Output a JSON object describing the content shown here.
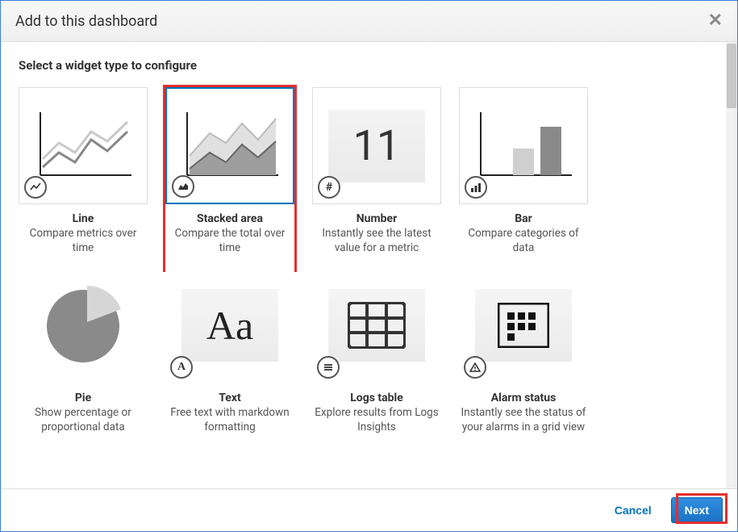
{
  "modal": {
    "title": "Add to this dashboard"
  },
  "section": {
    "title": "Select a widget type to configure"
  },
  "widgets": [
    {
      "id": "line",
      "name": "Line",
      "desc": "Compare metrics over time"
    },
    {
      "id": "area",
      "name": "Stacked area",
      "desc": "Compare the total over time",
      "selected": true
    },
    {
      "id": "number",
      "name": "Number",
      "desc": "Instantly see the latest value for a metric",
      "sample": "11"
    },
    {
      "id": "bar",
      "name": "Bar",
      "desc": "Compare categories of data"
    },
    {
      "id": "pie",
      "name": "Pie",
      "desc": "Show percentage or proportional data"
    },
    {
      "id": "text",
      "name": "Text",
      "desc": "Free text with markdown formatting",
      "sample": "Aa"
    },
    {
      "id": "logs",
      "name": "Logs table",
      "desc": "Explore results from Logs Insights"
    },
    {
      "id": "alarm",
      "name": "Alarm status",
      "desc": "Instantly see the status of your alarms in a grid view"
    }
  ],
  "footer": {
    "cancel": "Cancel",
    "next": "Next"
  }
}
